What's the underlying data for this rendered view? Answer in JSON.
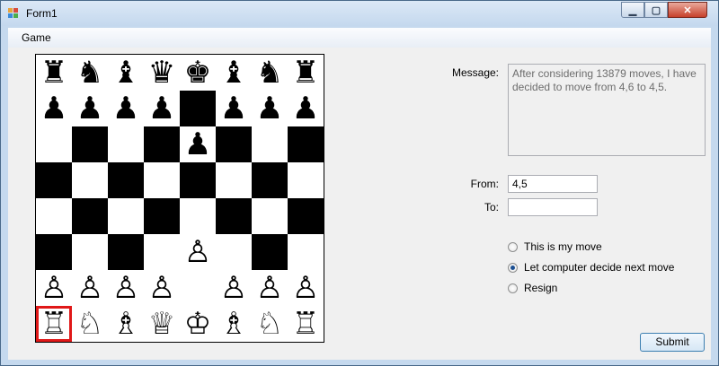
{
  "window": {
    "title": "Form1"
  },
  "titlebar": {
    "minimize_icon": "minimize-icon",
    "maximize_icon": "maximize-icon",
    "close_icon": "close-icon"
  },
  "menu": {
    "items": [
      {
        "label": "Game"
      }
    ]
  },
  "board": {
    "rows": [
      [
        "♜",
        "♞",
        "♝",
        "♛",
        "♚",
        "♝",
        "♞",
        "♜"
      ],
      [
        "♟",
        "♟",
        "♟",
        "♟",
        "",
        "♟",
        "♟",
        "♟"
      ],
      [
        "",
        "",
        "",
        "",
        "♟",
        "",
        "",
        ""
      ],
      [
        "",
        "",
        "",
        "",
        "",
        "",
        "",
        ""
      ],
      [
        "",
        "",
        "",
        "",
        "",
        "",
        "",
        ""
      ],
      [
        "",
        "",
        "",
        "",
        "♙",
        "",
        "",
        ""
      ],
      [
        "♙",
        "♙",
        "♙",
        "♙",
        "",
        "♙",
        "♙",
        "♙"
      ],
      [
        "♖",
        "♘",
        "♗",
        "♕",
        "♔",
        "♗",
        "♘",
        "♖"
      ]
    ],
    "selected_square": [
      7,
      0
    ],
    "light_color": "#ffffff",
    "dark_color": "#000000",
    "highlight_color": "#e01818"
  },
  "form": {
    "message_label": "Message:",
    "message_text": "After considering 13879 moves, I have decided to move from 4,6 to 4,5.",
    "from_label": "From:",
    "from_value": "4,5",
    "to_label": "To:",
    "to_value": "",
    "options": [
      {
        "label": "This is my move",
        "checked": false
      },
      {
        "label": "Let computer decide next move",
        "checked": true
      },
      {
        "label": "Resign",
        "checked": false
      }
    ],
    "submit_label": "Submit"
  }
}
